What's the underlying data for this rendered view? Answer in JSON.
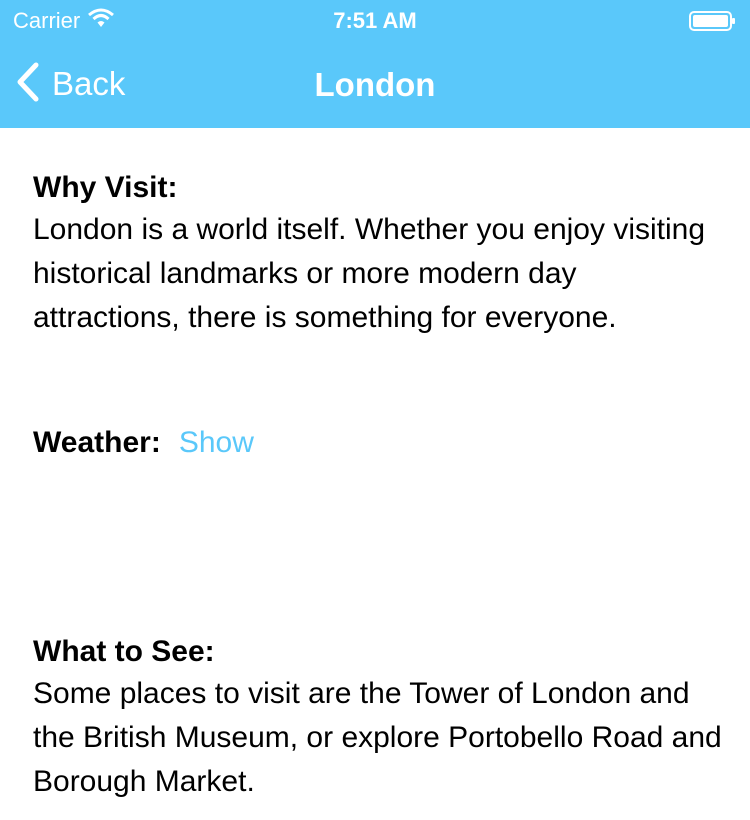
{
  "status_bar": {
    "carrier": "Carrier",
    "time": "7:51 AM"
  },
  "nav": {
    "back_label": "Back",
    "title": "London",
    "background": "#5ac8fa"
  },
  "why_visit": {
    "heading": "Why Visit:",
    "text": "London is a world itself. Whether you enjoy visiting historical landmarks or more modern day attractions, there is something for everyone."
  },
  "weather": {
    "heading": "Weather:",
    "link_label": "Show"
  },
  "what_to_see": {
    "heading": "What to See:",
    "text": "Some places to visit are the Tower of London and the British Museum, or explore Portobello Road and Borough Market."
  },
  "icons": {
    "back": "chevron-left-icon",
    "wifi": "wifi-icon",
    "battery": "battery-icon"
  }
}
